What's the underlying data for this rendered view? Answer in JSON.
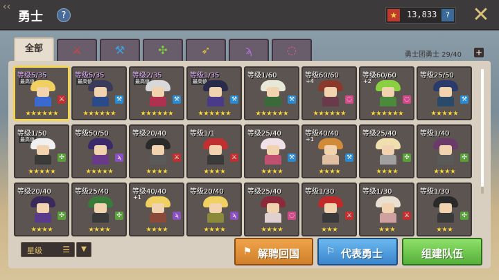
{
  "header": {
    "title": "勇士",
    "help": "?",
    "currency": "13,833",
    "currency_help": "?",
    "close": "✕",
    "back": "‹‹"
  },
  "tabs": [
    {
      "label": "全部",
      "icon": "all"
    },
    {
      "label": "",
      "icon": "sword-icon",
      "color": "#d94040",
      "glyph": "⚔"
    },
    {
      "label": "",
      "icon": "hammer-icon",
      "color": "#3aa0e0",
      "glyph": "⚒"
    },
    {
      "label": "",
      "icon": "crossbow-icon",
      "color": "#7ad040",
      "glyph": "✣"
    },
    {
      "label": "",
      "icon": "gun-icon",
      "color": "#e8c040",
      "glyph": "➶"
    },
    {
      "label": "",
      "icon": "staff-icon",
      "color": "#b070e0",
      "glyph": "ϡ"
    },
    {
      "label": "",
      "icon": "ring-icon",
      "color": "#e06090",
      "glyph": "◌"
    }
  ],
  "hero_count": "勇士团勇士 29/40",
  "plus": "+",
  "heroes": [
    {
      "level": "等级5/35",
      "stars": "★★★★★★",
      "badge": "最高值",
      "hair": "#f0d060",
      "body": "#3a6ad0",
      "cls": "#c03030",
      "cls_glyph": "⚔",
      "purple": true,
      "sel": true
    },
    {
      "level": "等级5/35",
      "stars": "★★★★★★",
      "badge": "最高值",
      "hair": "#3a3a5a",
      "body": "#2a4a8a",
      "cls": "#2a8ad0",
      "cls_glyph": "⚒",
      "purple": true
    },
    {
      "level": "等级2/35",
      "stars": "★★★★★★",
      "badge": "最高值",
      "hair": "#d8d8d8",
      "body": "#b03050",
      "cls": "#2a8ad0",
      "cls_glyph": "⚒",
      "purple": true
    },
    {
      "level": "等级1/35",
      "stars": "★★★★★★",
      "badge": "最高值",
      "hair": "#2a2a4a",
      "body": "#4a3a8a",
      "cls": "#2a8ad0",
      "cls_glyph": "⚒",
      "purple": true
    },
    {
      "level": "等级1/60",
      "stars": "★★★★★★",
      "hair": "#e8e8d8",
      "body": "#3a6a3a",
      "cls": "#2a8ad0",
      "cls_glyph": "⚒"
    },
    {
      "level": "等级60/60",
      "stars": "★★★★★★",
      "badge2": "+4",
      "hair": "#8a3a2a",
      "body": "#6a3a4a",
      "cls": "#d04a8a",
      "cls_glyph": "◌"
    },
    {
      "level": "等级60/60",
      "stars": "★★★★★★",
      "badge2": "+2",
      "hair": "#8ad040",
      "body": "#4a8a3a",
      "cls": "#d04a8a",
      "cls_glyph": "◌"
    },
    {
      "level": "等级25/50",
      "stars": "★★★★★",
      "hair": "#2a3a6a",
      "body": "#2a4a6a",
      "cls": "#2a8ad0",
      "cls_glyph": "⚒"
    },
    {
      "level": "等级1/50",
      "stars": "★★★★★",
      "badge": "最高值",
      "hair": "#f0f0f0",
      "body": "#3a3a3a",
      "cls": "#5aa03a",
      "cls_glyph": "✣"
    },
    {
      "level": "等级50/50",
      "stars": "★★★★★",
      "hair": "#3a2a6a",
      "body": "#6a3a8a",
      "cls": "#8a50c0",
      "cls_glyph": "ϡ"
    },
    {
      "level": "等级20/40",
      "stars": "★★★★",
      "hair": "#2a2a2a",
      "body": "#5a5a5a",
      "cls": "#c03030",
      "cls_glyph": "⚔"
    },
    {
      "level": "等级1/1",
      "stars": "★★★★",
      "hair": "#c03030",
      "body": "#3a3a3a",
      "cls": "#c03030",
      "cls_glyph": "⚔"
    },
    {
      "level": "等级25/40",
      "stars": "★★★★",
      "hair": "#f0e0e8",
      "body": "#c05070",
      "cls": "#2a8ad0",
      "cls_glyph": "⚒"
    },
    {
      "level": "等级40/40",
      "stars": "★★★★",
      "badge2": "+1",
      "hair": "#d08a3a",
      "body": "#e0c0a0",
      "cls": "#2a8ad0",
      "cls_glyph": "⚒"
    },
    {
      "level": "等级25/40",
      "stars": "★★★★",
      "hair": "#f0e0b0",
      "body": "#a0a0a0",
      "cls": "#5aa03a",
      "cls_glyph": "✣"
    },
    {
      "level": "等级1/40",
      "stars": "★★★★",
      "hair": "#6a3a6a",
      "body": "#5a5a5a",
      "cls": "#5aa03a",
      "cls_glyph": "✣"
    },
    {
      "level": "等级20/40",
      "stars": "★★★★",
      "hair": "#3a2a5a",
      "body": "#5a3a8a",
      "cls": "#5aa03a",
      "cls_glyph": "✣"
    },
    {
      "level": "等级25/40",
      "stars": "★★★★",
      "hair": "#3a7a3a",
      "body": "#3a3a3a",
      "cls": "#5aa03a",
      "cls_glyph": "✣"
    },
    {
      "level": "等级40/40",
      "stars": "★★★★",
      "badge2": "+1",
      "hair": "#f0d060",
      "body": "#8a4a3a",
      "cls": "#8a50c0",
      "cls_glyph": "ϡ"
    },
    {
      "level": "等级20/40",
      "stars": "★★★★",
      "hair": "#f0d060",
      "body": "#8a8a3a",
      "cls": "#8a50c0",
      "cls_glyph": "ϡ"
    },
    {
      "level": "等级25/40",
      "stars": "★★★★",
      "hair": "#8a2a3a",
      "body": "#e0d0d0",
      "cls": "#d04a8a",
      "cls_glyph": "◌"
    },
    {
      "level": "等级1/30",
      "stars": "★★★",
      "hair": "#c02a2a",
      "body": "#3a3a3a",
      "cls": "#c03030",
      "cls_glyph": "⚔"
    },
    {
      "level": "等级1/30",
      "stars": "★★★",
      "hair": "#e8e0d0",
      "body": "#d0a0a0",
      "cls": "#c03030",
      "cls_glyph": "⚔"
    },
    {
      "level": "等级1/30",
      "stars": "★★★",
      "hair": "#2a2a2a",
      "body": "#3a3a3a",
      "cls": "#5aa03a",
      "cls_glyph": "✣"
    }
  ],
  "sort": {
    "label": "星级",
    "icon": "☰",
    "arrow": "▼"
  },
  "buttons": {
    "dismiss": "解聘回国",
    "representative": "代表勇士",
    "team": "组建队伍"
  }
}
